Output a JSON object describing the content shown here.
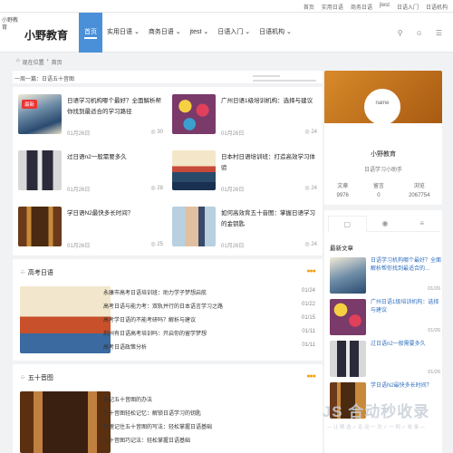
{
  "topbar": {
    "links": [
      "首页",
      "实用日语",
      "商务日语",
      "jtest",
      "日语入门",
      "日语机构"
    ]
  },
  "header": {
    "logo_alt": "小野教育",
    "site_name": "小野教育",
    "nav": [
      "首页",
      "实用日语",
      "商务日语",
      "jtest",
      "日语入门",
      "日语机构"
    ],
    "active_index": 0
  },
  "breadcrumb": {
    "label": "现在位置",
    "current": "首页"
  },
  "slider": {
    "title": "一周一篇：日语五十音图"
  },
  "articles": [
    {
      "title": "日语学习机构哪个最好？全面解析帮你找到最适合的学习路径",
      "date": "01月26日",
      "views": "30",
      "badge": "最新"
    },
    {
      "title": "广州日语1级培训机构：选择与建议",
      "date": "01月26日",
      "views": "24",
      "badge": ""
    },
    {
      "title": "过日语n2一般需要多久",
      "date": "01月26日",
      "views": "28",
      "badge": ""
    },
    {
      "title": "日本村日语培训班：打造高效学习体验",
      "date": "01月26日",
      "views": "24",
      "badge": ""
    },
    {
      "title": "学日语N2最快多长时间？",
      "date": "01月26日",
      "views": "25",
      "badge": ""
    },
    {
      "title": "如何高效背五十音图：掌握日语学习的金钥匙",
      "date": "01月26日",
      "views": "24",
      "badge": ""
    }
  ],
  "section1": {
    "title": "高考日语",
    "items": [
      {
        "t": "永康市高考日语培训班：助力学子梦想启航",
        "d": "01/24"
      },
      {
        "t": "高考日语与能力考：双轨并行的日本语言学习之路",
        "d": "01/22"
      },
      {
        "t": "高考学日语的不能考研吗？解析与建议",
        "d": "01/15"
      },
      {
        "t": "荆州有日语高考培训吗：开启你的留学梦想",
        "d": "01/11"
      },
      {
        "t": "高考日语政策分析",
        "d": "01/11"
      }
    ]
  },
  "section2": {
    "title": "五十音图",
    "items": [
      {
        "t": "速记五十音图的办法",
        "d": ""
      },
      {
        "t": "五十音图轻松记忆：解锁日语学习的钥匙",
        "d": ""
      },
      {
        "t": "快速记住五十音图的写法：轻松掌握日语基础",
        "d": ""
      },
      {
        "t": "五十音图巧记法：轻松掌握日语基础",
        "d": ""
      }
    ]
  },
  "profile": {
    "avatar_label": "name",
    "name": "小野教育",
    "desc": "日语学习小助手",
    "stats": [
      {
        "label": "文章",
        "value": "9976"
      },
      {
        "label": "留言",
        "value": "0"
      },
      {
        "label": "浏览",
        "value": "2067754"
      }
    ]
  },
  "sidebar": {
    "section_title": "最新文章",
    "items": [
      {
        "t": "日语学习机构哪个最好？全面解析帮你找到最适合的...",
        "d": "01/26"
      },
      {
        "t": "广州日语1级培训机构：选择与建议",
        "d": "01/26"
      },
      {
        "t": "过日语n2一般需要多久",
        "d": "01/26"
      },
      {
        "t": "学日语N2最快多长时间？",
        "d": ""
      }
    ]
  },
  "watermark": {
    "text": "JS 合动秒收录",
    "sub": "— 让 精 选 ✓ 走 动 一 次 ✓ 一 网 ✓ 收 录 —"
  }
}
